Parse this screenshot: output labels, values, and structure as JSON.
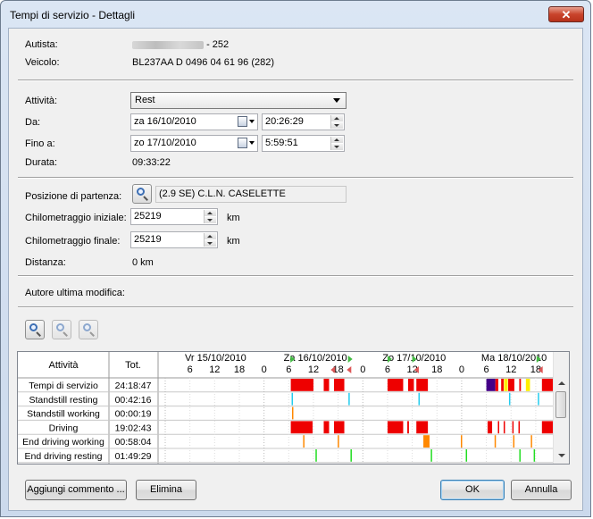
{
  "window": {
    "title": "Tempi di servizio - Dettagli",
    "close_glyph": "✕"
  },
  "driver": {
    "label": "Autista:",
    "suffix": "- 252"
  },
  "vehicle": {
    "label": "Veicolo:",
    "value": "BL237AA D 0496 04 61 96   (282)"
  },
  "activity": {
    "label": "Attività:",
    "value": "Rest"
  },
  "from": {
    "label": "Da:",
    "date": "za 16/10/2010",
    "time": "20:26:29"
  },
  "to": {
    "label": "Fino a:",
    "date": "zo 17/10/2010",
    "time": "5:59:51"
  },
  "duration": {
    "label": "Durata:",
    "value": "09:33:22"
  },
  "start_position": {
    "label": "Posizione di partenza:",
    "value": "(2.9 SE) C.L.N.  CASELETTE"
  },
  "initial_km": {
    "label": "Chilometraggio iniziale:",
    "value": "25219",
    "unit": "km"
  },
  "final_km": {
    "label": "Chilometraggio finale:",
    "value": "25219",
    "unit": "km"
  },
  "distance": {
    "label": "Distanza:",
    "value": "0 km"
  },
  "last_edit": {
    "label": "Autore ultima modifica:"
  },
  "chart": {
    "col_activity": "Attività",
    "col_total": "Tot.",
    "days": [
      "Vr 15/10/2010",
      "Za 16/10/2010",
      "Zo 17/10/2010",
      "Ma 18/10/2010"
    ],
    "hour_ticks": [
      "6",
      "12",
      "18",
      "0",
      "6",
      "12",
      "18",
      "0",
      "6",
      "12",
      "18",
      "0",
      "6",
      "12",
      "18"
    ],
    "rows": [
      {
        "name": "Tempi di servizio",
        "total": "24:18:47"
      },
      {
        "name": "Standstill resting",
        "total": "00:42:16"
      },
      {
        "name": "Standstill working",
        "total": "00:00:19"
      },
      {
        "name": "Driving",
        "total": "19:02:43"
      },
      {
        "name": "End driving working",
        "total": "00:58:04"
      },
      {
        "name": "End driving resting",
        "total": "01:49:29"
      }
    ],
    "colors": {
      "red": "#ee0000",
      "cyan": "#22ccee",
      "orange": "#ff8800",
      "green": "#22dd22",
      "yellow": "#ffee00",
      "purple": "#440088",
      "magenta": "#cc00cc",
      "marker_green": "#44bb44",
      "marker_red": "#dd5555"
    }
  },
  "buttons": {
    "add_comment": "Aggiungi commento ...",
    "delete": "Elimina",
    "ok": "OK",
    "cancel": "Annulla"
  }
}
